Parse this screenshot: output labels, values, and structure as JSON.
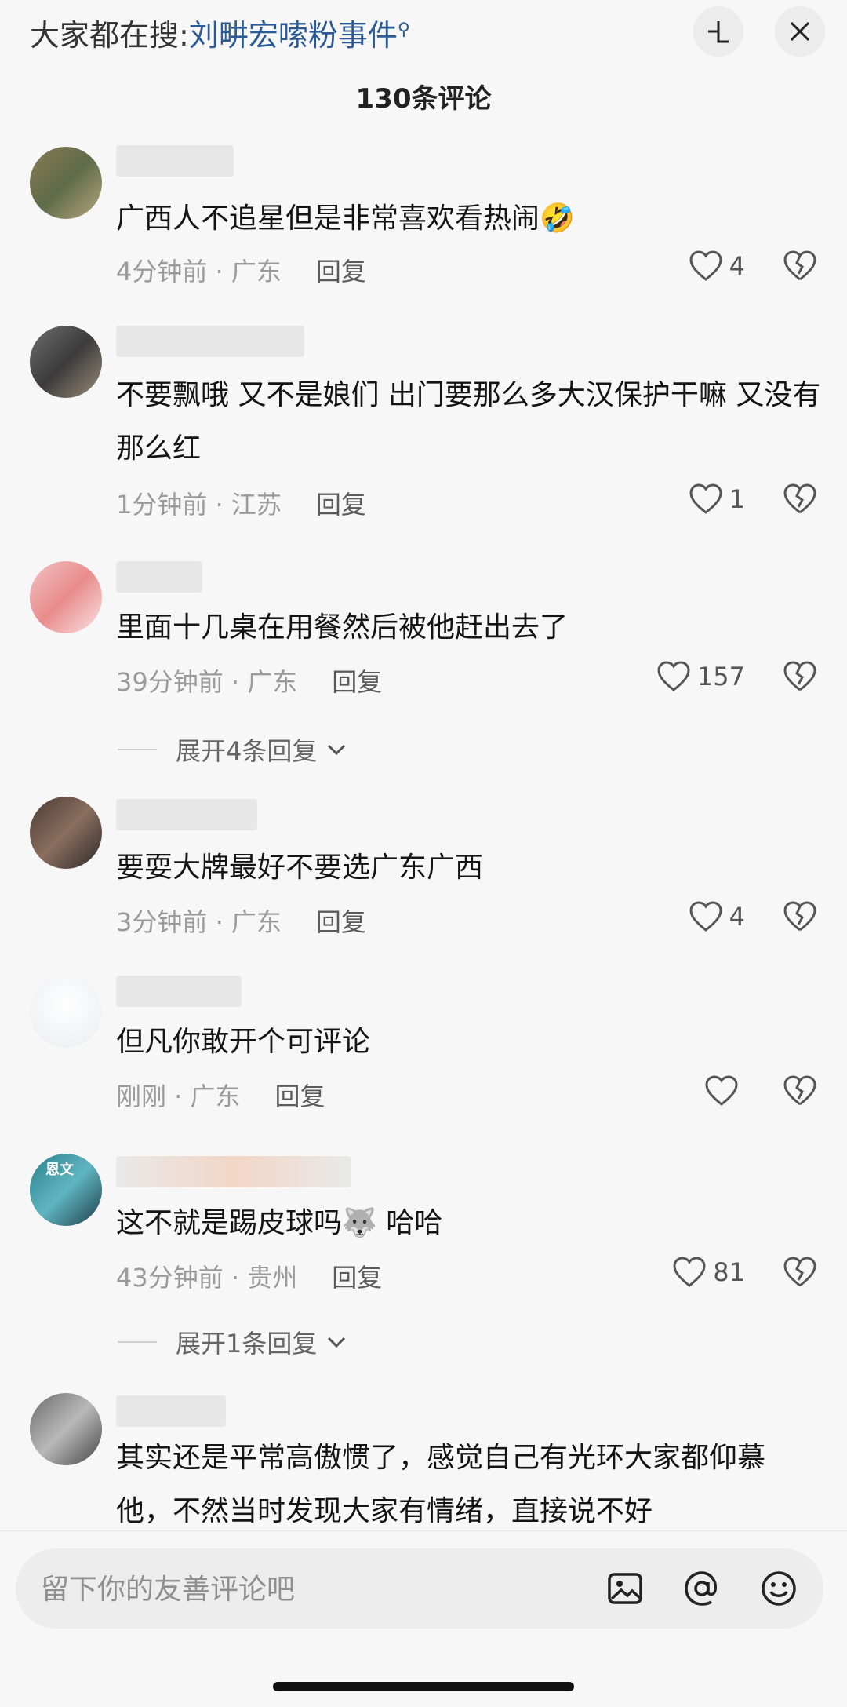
{
  "header": {
    "search_prefix": "大家都在搜:",
    "search_keyword": "刘畊宏嗦粉事件",
    "comment_count": "130条评论"
  },
  "comments": [
    {
      "text": "广西人不追星但是非常喜欢看热闹🤣",
      "time": "4分钟前 · 广东",
      "reply": "回复",
      "likes": "4"
    },
    {
      "text": "不要飘哦  又不是娘们 出门要那么多大汉保护干嘛 又没有那么红",
      "time": "1分钟前 · 江苏",
      "reply": "回复",
      "likes": "1"
    },
    {
      "text": "里面十几桌在用餐然后被他赶出去了",
      "time": "39分钟前 · 广东",
      "reply": "回复",
      "likes": "157",
      "expand": "展开4条回复"
    },
    {
      "text": "要耍大牌最好不要选广东广西",
      "time": "3分钟前 · 广东",
      "reply": "回复",
      "likes": "4"
    },
    {
      "text": "但凡你敢开个可评论",
      "time": "刚刚 · 广东",
      "reply": "回复",
      "likes": ""
    },
    {
      "text": "这不就是踢皮球吗🐺 哈哈",
      "time": "43分钟前 · 贵州",
      "reply": "回复",
      "likes": "81",
      "expand": "展开1条回复",
      "badge": "恩文"
    },
    {
      "text": "其实还是平常高傲惯了，感觉自己有光环大家都仰慕他，不然当时发现大家有情绪，直接说不好"
    }
  ],
  "input": {
    "placeholder": "留下你的友善评论吧"
  },
  "icons": {
    "collapse": "collapse-icon",
    "close": "close-icon",
    "heart": "heart-icon",
    "broken_heart": "broken-heart-icon",
    "image": "image-icon",
    "at": "at-icon",
    "emoji": "emoji-icon"
  },
  "colors": {
    "keyword": "#2b5a95",
    "background": "#f7f7f7"
  }
}
